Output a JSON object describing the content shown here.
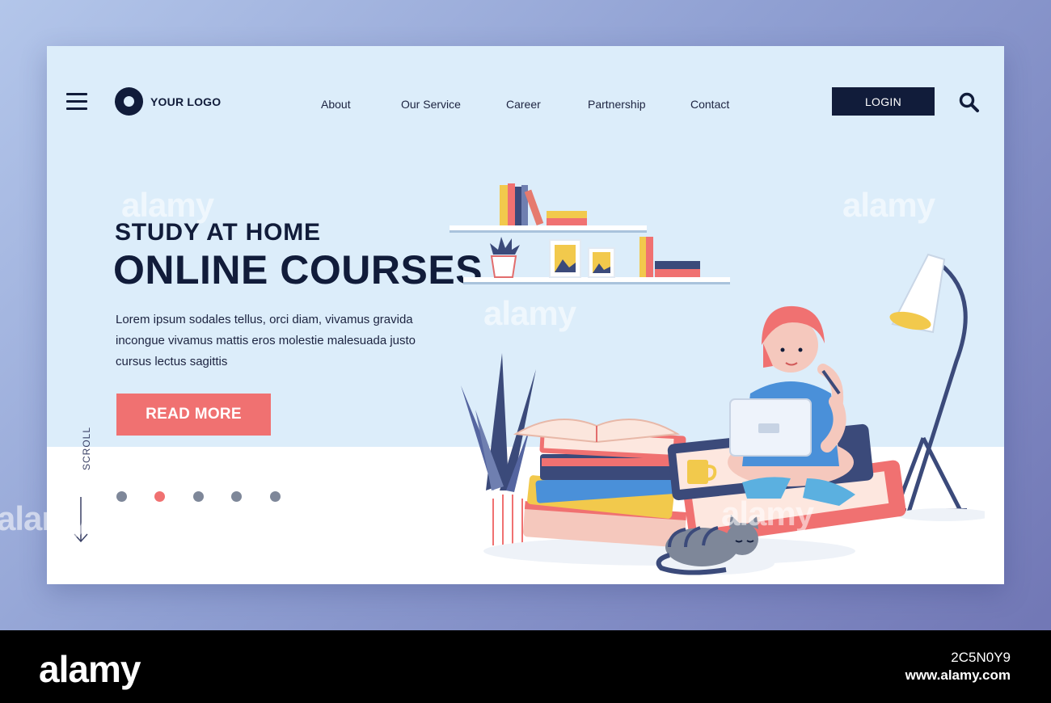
{
  "header": {
    "logo_text": "YOUR LOGO",
    "nav": [
      "About",
      "Our Service",
      "Career",
      "Partnership",
      "Contact"
    ],
    "login_label": "LOGIN"
  },
  "hero": {
    "subtitle": "STUDY AT HOME",
    "title": "ONLINE COURSES",
    "description": "Lorem ipsum sodales tellus, orci diam, vivamus gravida incongue vivamus mattis eros molestie malesuada justo cursus lectus sagittis",
    "cta_label": "READ MORE"
  },
  "scroll": {
    "label": "SCROLL",
    "dot_count": 5,
    "active_dot": 2
  },
  "watermark": {
    "brand": "alamy",
    "image_id": "2C5N0Y9",
    "url": "www.alamy.com"
  },
  "colors": {
    "navy": "#111c3a",
    "accent": "#f07171",
    "panel": "#dcedfa",
    "background_start": "#b3c6ea",
    "background_end": "#6f74b3"
  },
  "icons": [
    "hamburger-menu-icon",
    "logo-mark-icon",
    "search-icon",
    "scroll-down-arrow-icon"
  ]
}
